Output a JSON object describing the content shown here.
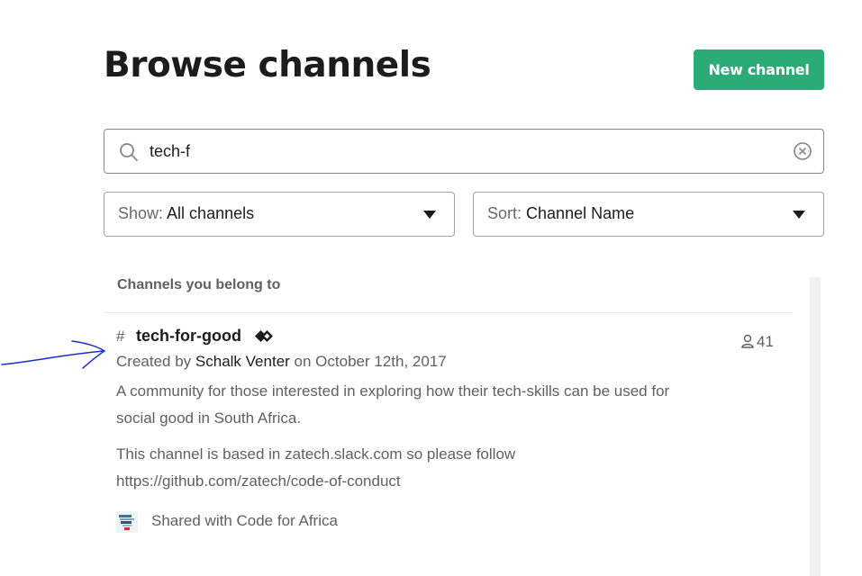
{
  "header": {
    "title": "Browse channels",
    "new_channel_label": "New channel",
    "brand_color": "#2bac76"
  },
  "search": {
    "value": "tech-f",
    "icon": "search-icon",
    "clear_icon": "clear-circle-x-icon"
  },
  "filters": {
    "show": {
      "label": "Show:",
      "value": "All channels"
    },
    "sort": {
      "label": "Sort:",
      "value": "Channel Name"
    }
  },
  "results": {
    "section_title": "Channels you belong to",
    "channels": [
      {
        "prefix": "#",
        "name": "tech-for-good",
        "shared_icon": "shared-channel-diamond-icon",
        "member_count": "41",
        "created_prefix": "Created by",
        "creator": "Schalk Venter",
        "created_suffix": "on October 12th, 2017",
        "description_1": "A community for those interested in exploring how their tech-skills can be used for social good in South Africa.",
        "description_2": "This channel is based in zatech.slack.com so please follow https://github.com/zatech/code-of-conduct",
        "shared_with": "Shared with Code for Africa"
      }
    ]
  },
  "annotation": {
    "color": "#1a2fd1"
  }
}
